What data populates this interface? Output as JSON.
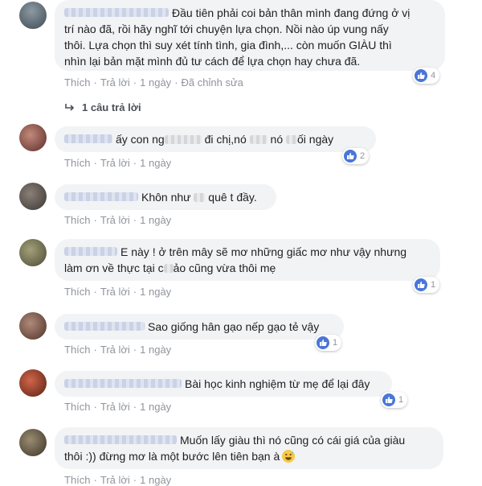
{
  "actions": {
    "like": "Thích",
    "reply": "Trả lời",
    "separator": "·",
    "edited": "Đã chỉnh sửa"
  },
  "comments": [
    {
      "lines": [
        "Đầu tiên phải coi bản thân mình đang đứng ở vị",
        "trí nào đã, rồi hãy nghĩ tới chuyện lựa chọn. Nồi nào úp vung nấy",
        "thôi. Lựa chọn thì suy xét tính tình, gia đình,... còn muốn GIÀU thì",
        "nhìn lại bản mặt mình đủ tư cách để lựa chọn hay chưa đã."
      ],
      "time": "1 ngày",
      "likes": "4",
      "replies": "1 câu trả lời"
    },
    {
      "text_a": "ấy con ng",
      "text_b": " đi chị,nó ",
      "text_c": " nó ",
      "text_d": "ối ngày",
      "time": "1 ngày",
      "likes": "2"
    },
    {
      "text_a": "Khôn như ",
      "text_b": " quê t đầy.",
      "time": "1 ngày"
    },
    {
      "line1": "E này ! ở trên mây sẽ mơ những giấc mơ như vậy nhưng",
      "line2_a": "làm ơn về thực tại c",
      "line2_b": "ảo cũng vừa thôi mẹ",
      "time": "1 ngày",
      "likes": "1"
    },
    {
      "text": "Sao giống hân gạo nếp gạo tẻ vậy",
      "time": "1 ngày",
      "likes": "1"
    },
    {
      "text": "Bài học kinh nghiệm từ mẹ để lại đây",
      "time": "1 ngày",
      "likes": "1"
    },
    {
      "line1": "Muốn lấy giàu thì nó cũng có cái giá của giàu",
      "line2": "thôi :)) đừng mơ là một bước lên tiên bạn à",
      "time": "1 ngày"
    }
  ],
  "colors": {
    "bubble": "#f2f3f5",
    "meta": "#90949c",
    "like_badge": "#4a76d9"
  },
  "icons": {
    "like": "thumbs-up-icon",
    "reply_arrow": "reply-arrow-icon",
    "emoji": "grinning-sweat-emoji"
  }
}
